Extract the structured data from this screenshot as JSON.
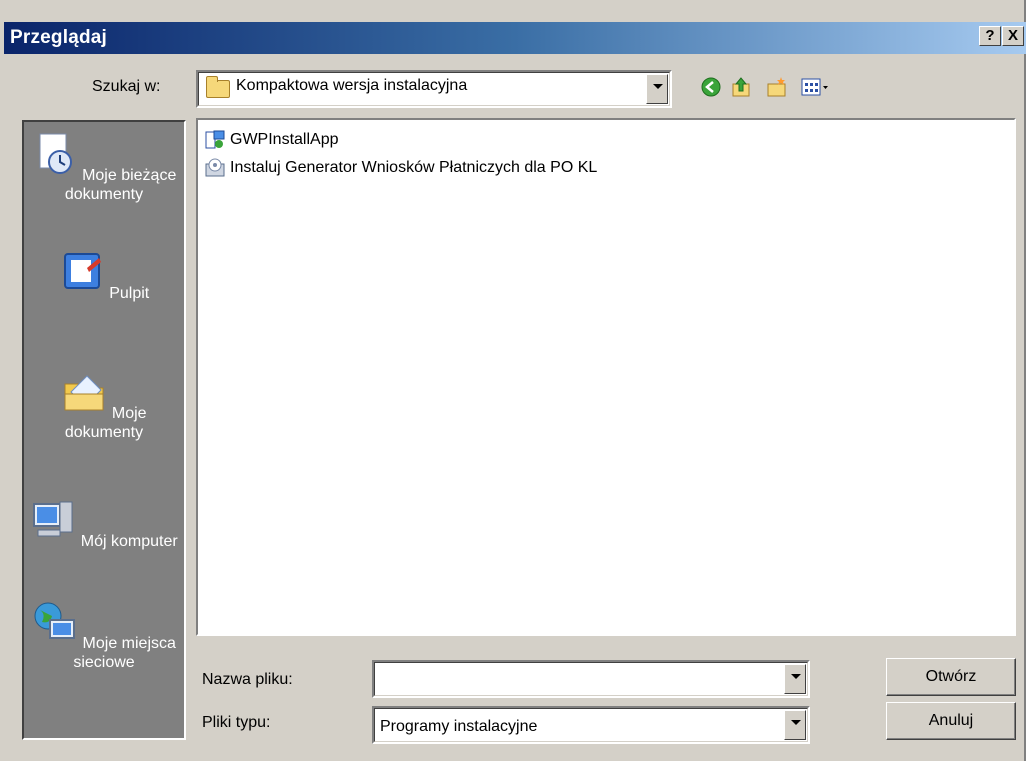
{
  "dialog": {
    "title": "Przeglądaj",
    "help_label": "?",
    "close_label": "X"
  },
  "lookin": {
    "label": "Szukaj w:",
    "value": "Kompaktowa wersja instalacyjna"
  },
  "toolbar": {
    "icons": [
      "back-icon",
      "up-folder-icon",
      "new-folder-icon",
      "view-menu-icon"
    ]
  },
  "places": [
    {
      "label": "Moje bieżące dokumenty",
      "icon": "recent-documents-icon"
    },
    {
      "label": "Pulpit",
      "icon": "desktop-icon"
    },
    {
      "label": "Moje dokumenty",
      "icon": "my-documents-icon"
    },
    {
      "label": "Mój komputer",
      "icon": "my-computer-icon"
    },
    {
      "label": "Moje miejsca sieciowe",
      "icon": "network-places-icon"
    }
  ],
  "files": [
    {
      "name": "GWPInstallApp",
      "icon": "installer-app-icon"
    },
    {
      "name": "Instaluj Generator Wniosków Płatniczych dla PO KL",
      "icon": "setup-package-icon"
    }
  ],
  "filename": {
    "label": "Nazwa pliku:",
    "value": ""
  },
  "filetype": {
    "label": "Pliki typu:",
    "value": "Programy instalacyjne"
  },
  "buttons": {
    "open": "Otwórz",
    "cancel": "Anuluj"
  },
  "colors": {
    "title_start": "#0a246a",
    "title_end": "#a6caf0",
    "face": "#d4d0c8",
    "places_bg": "#808080"
  }
}
